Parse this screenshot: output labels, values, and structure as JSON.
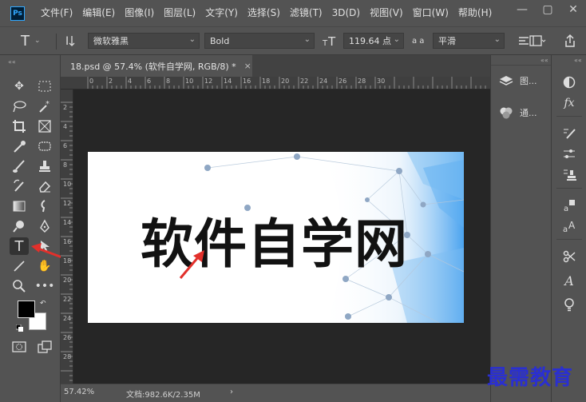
{
  "menubar": {
    "logo": "Ps",
    "items": [
      "文件(F)",
      "编辑(E)",
      "图像(I)",
      "图层(L)",
      "文字(Y)",
      "选择(S)",
      "滤镜(T)",
      "3D(D)",
      "视图(V)",
      "窗口(W)",
      "帮助(H)"
    ]
  },
  "window_controls": {
    "minimize": "—",
    "restore": "▢",
    "close": "✕"
  },
  "options": {
    "tool_glyph": "T",
    "font_family": "微软雅黑",
    "font_style": "Bold",
    "font_size": "119.64 点",
    "antialias": "平滑",
    "aa_label": "a a"
  },
  "tab": {
    "title": "18.psd @ 57.4% (软件自学网, RGB/8) *",
    "close": "×"
  },
  "ruler_top": [
    "0",
    "2",
    "4",
    "6",
    "8",
    "10",
    "12",
    "14",
    "16",
    "18",
    "20",
    "22",
    "24",
    "26",
    "28",
    "30"
  ],
  "ruler_left": [
    "2",
    "4",
    "6",
    "8",
    "10",
    "12",
    "14",
    "16",
    "18",
    "20",
    "22",
    "24",
    "26",
    "28"
  ],
  "canvas": {
    "text": "软件自学网"
  },
  "status": {
    "zoom": "57.42%",
    "doc": "文档:982.6K/2.35M",
    "arrow": "›"
  },
  "panels": {
    "layers": "图...",
    "channels": "通..."
  },
  "watermark": "最需教育",
  "colors": {
    "accent": "#31a8ff",
    "arrow": "#e2302b",
    "watermark": "#2a2fd1",
    "canvas_bg": "#262626"
  }
}
